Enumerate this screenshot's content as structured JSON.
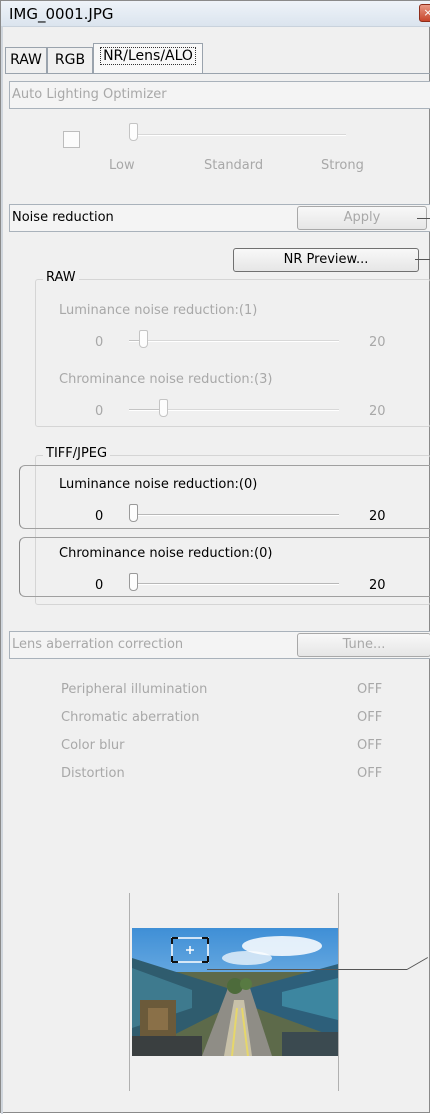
{
  "window": {
    "title": "IMG_0001.JPG",
    "close_glyph": "×"
  },
  "tabs": [
    {
      "label": "RAW"
    },
    {
      "label": "RGB"
    },
    {
      "label": "NR/Lens/ALO"
    }
  ],
  "alo": {
    "header": "Auto Lighting Optimizer",
    "checked": false,
    "slider_labels": [
      "Low",
      "Standard",
      "Strong"
    ]
  },
  "noise_reduction": {
    "header": "Noise reduction",
    "apply_label": "Apply",
    "preview_label": "NR Preview...",
    "raw_group": {
      "title": "RAW",
      "luminance_label": "Luminance noise reduction:(1)",
      "luminance_min": "0",
      "luminance_max": "20",
      "chrominance_label": "Chrominance noise reduction:(3)",
      "chrominance_min": "0",
      "chrominance_max": "20"
    },
    "tiff_group": {
      "title": "TIFF/JPEG",
      "luminance_label": "Luminance noise reduction:(0)",
      "luminance_min": "0",
      "luminance_max": "20",
      "chrominance_label": "Chrominance noise reduction:(0)",
      "chrominance_min": "0",
      "chrominance_max": "20"
    }
  },
  "lens": {
    "header": "Lens aberration correction",
    "tune_label": "Tune...",
    "items": [
      {
        "label": "Peripheral illumination",
        "value": "OFF"
      },
      {
        "label": "Chromatic aberration",
        "value": "OFF"
      },
      {
        "label": "Color blur",
        "value": "OFF"
      },
      {
        "label": "Distortion",
        "value": "OFF"
      }
    ]
  },
  "navigator": {
    "image_desc": "train-on-tracks-thumbnail"
  },
  "colors": {
    "disabled_text": "#a8a8a8",
    "panel_bg": "#f0f0f0",
    "close_red": "#c7452b"
  }
}
